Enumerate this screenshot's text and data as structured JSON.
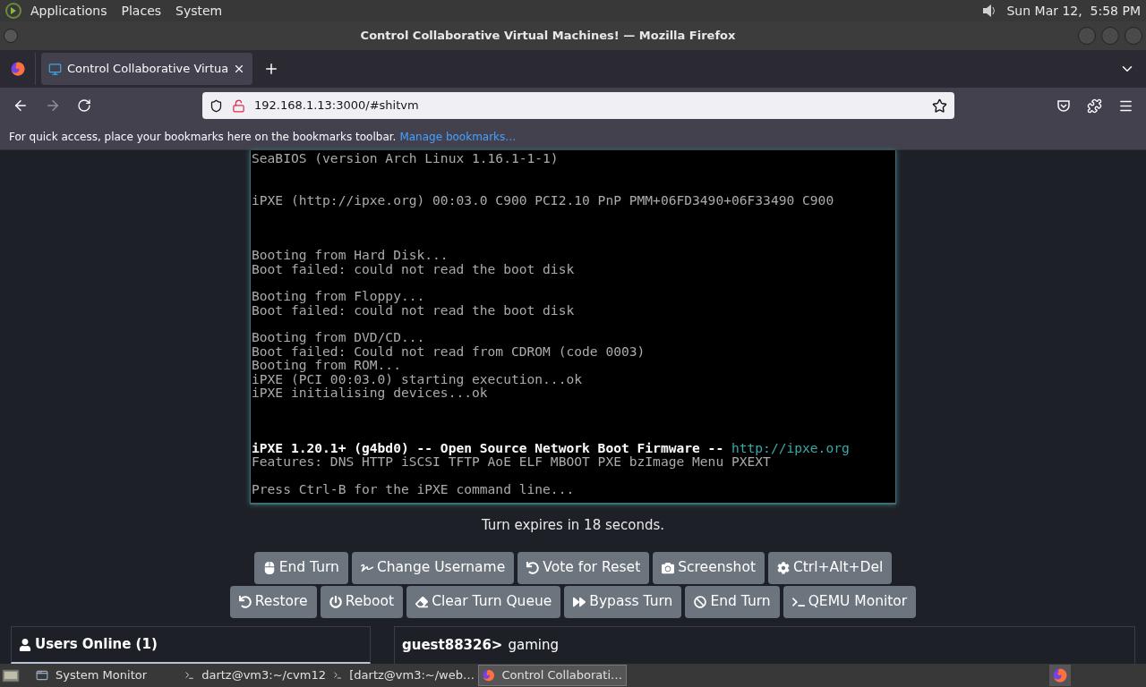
{
  "top_panel": {
    "menus": [
      "Applications",
      "Places",
      "System"
    ],
    "clock": "Sun Mar 12,  5:58 PM"
  },
  "window": {
    "title": "Control Collaborative Virtual Machines! — Mozilla Firefox"
  },
  "tabs": [
    {
      "label": "Control Collaborative Virtua",
      "selected": true
    }
  ],
  "address": {
    "value": "192.168.1.13:3000/#shitvm"
  },
  "bookmarks_bar": {
    "message": "For quick access, place your bookmarks here on the bookmarks toolbar.",
    "link": "Manage bookmarks…"
  },
  "vm_screen": {
    "blocks": [
      [
        {
          "text": "SeaBIOS (version Arch Linux 1.16.1-1-1)"
        }
      ],
      [
        {
          "text": "iPXE (http://ipxe.org) 00:03.0 C900 PCI2.10 PnP PMM+06FD3490+06F33490 C900"
        }
      ],
      [
        {
          "text": "Booting from Hard Disk..."
        },
        {
          "text": "Boot failed: could not read the boot disk"
        }
      ],
      [
        {
          "text": "Booting from Floppy..."
        },
        {
          "text": "Boot failed: could not read the boot disk"
        }
      ],
      [
        {
          "text": "Booting from DVD/CD..."
        },
        {
          "text": "Boot failed: Could not read from CDROM (code 0003)"
        },
        {
          "text": "Booting from ROM..."
        },
        {
          "text": "iPXE (PCI 00:03.0) starting execution...ok"
        },
        {
          "text": "iPXE initialising devices...ok"
        }
      ],
      [
        {
          "text": "iPXE 1.20.1+ (g4bd0) -- Open Source Network Boot Firmware -- ",
          "link": "http://ipxe.org",
          "bright": true
        },
        {
          "text": "Features: DNS HTTP iSCSI TFTP AoE ELF MBOOT PXE bzImage Menu PXEXT"
        }
      ],
      [
        {
          "text": "Press Ctrl-B for the iPXE command line..."
        }
      ]
    ]
  },
  "turn_status": "Turn expires in 18 seconds.",
  "button_rows": [
    [
      {
        "label": "End Turn"
      },
      {
        "label": "Change Username"
      },
      {
        "label": "Vote for Reset"
      },
      {
        "label": "Screenshot"
      },
      {
        "label": "Ctrl+Alt+Del"
      }
    ],
    [
      {
        "label": "Restore"
      },
      {
        "label": "Reboot"
      },
      {
        "label": "Clear Turn Queue"
      },
      {
        "label": "Bypass Turn"
      },
      {
        "label": "End Turn"
      },
      {
        "label": "QEMU Monitor"
      }
    ]
  ],
  "users_panel": {
    "title": "Users Online (1)"
  },
  "chat": [
    {
      "user": "guest88326>",
      "message": "gaming"
    }
  ],
  "taskbar": [
    {
      "label": "System Monitor",
      "selected": false
    },
    {
      "label": "dartz@vm3:~/cvm12",
      "selected": false
    },
    {
      "label": "[dartz@vm3:~/web…",
      "selected": false
    },
    {
      "label": "Control Collaborati…",
      "selected": true
    }
  ]
}
